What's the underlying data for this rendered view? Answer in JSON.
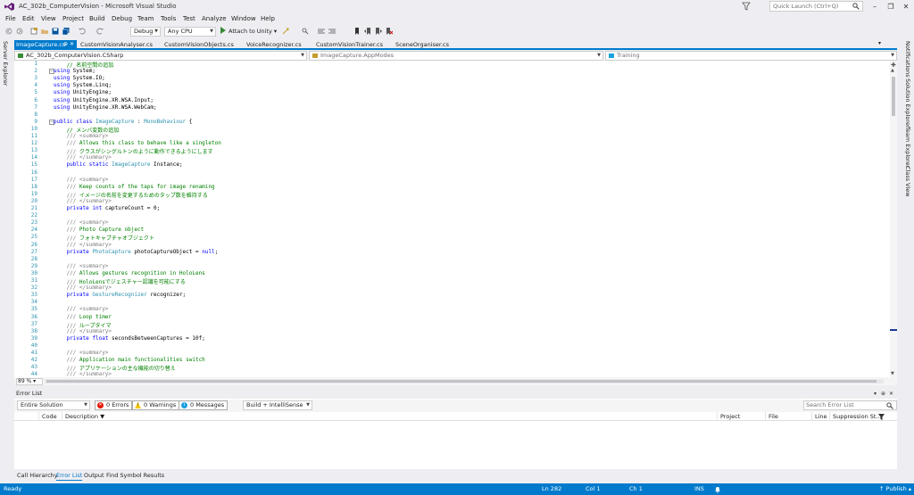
{
  "window": {
    "title": "AC_302b_ComputerVision - Microsoft Visual Studio"
  },
  "quick_launch": {
    "placeholder": "Quick Launch (Ctrl+Q)"
  },
  "menu": [
    "File",
    "Edit",
    "View",
    "Project",
    "Build",
    "Debug",
    "Team",
    "Tools",
    "Test",
    "Analyze",
    "Window",
    "Help"
  ],
  "toolbar": {
    "config": "Debug",
    "platform": "Any CPU",
    "run_label": "Attach to Unity"
  },
  "left_sidebar": {
    "label": "Server Explorer"
  },
  "right_sidebar": [
    "Notifications",
    "Solution Explorer",
    "Team Explorer",
    "Class View"
  ],
  "tabs": [
    "ImageCapture.cs",
    "CustomVisionAnalyser.cs",
    "CustomVisionObjects.cs",
    "VoiceRecognizer.cs",
    "CustomVisionTrainer.cs",
    "SceneOrganiser.cs"
  ],
  "navbar": {
    "project": "AC_302b_ComputerVision.CSharp",
    "type": "ImageCapture.AppModes",
    "member": "Training"
  },
  "code_lines": [
    {
      "n": "1",
      "t": "    // 名前空間の追加"
    },
    {
      "n": "2",
      "t": "using System;"
    },
    {
      "n": "3",
      "t": "using System.IO;"
    },
    {
      "n": "4",
      "t": "using System.Linq;"
    },
    {
      "n": "5",
      "t": "using UnityEngine;"
    },
    {
      "n": "6",
      "t": "using UnityEngine.XR.WSA.Input;"
    },
    {
      "n": "7",
      "t": "using UnityEngine.XR.WSA.WebCam;"
    },
    {
      "n": "8",
      "t": ""
    },
    {
      "n": "9",
      "t": "public class ImageCapture : MonoBehaviour {"
    },
    {
      "n": "10",
      "t": "    // メンバ変数の追加"
    },
    {
      "n": "11",
      "t": "    /// <summary>"
    },
    {
      "n": "12",
      "t": "    /// Allows this class to behave like a singleton"
    },
    {
      "n": "13",
      "t": "    /// クラスがシングルトンのように動作できるようにします"
    },
    {
      "n": "14",
      "t": "    /// </summary>"
    },
    {
      "n": "15",
      "t": "    public static ImageCapture Instance;"
    },
    {
      "n": "16",
      "t": ""
    },
    {
      "n": "17",
      "t": "    /// <summary>"
    },
    {
      "n": "18",
      "t": "    /// Keep counts of the taps for image renaming"
    },
    {
      "n": "19",
      "t": "    /// イメージの名前を変更するためのタップ数を維持する"
    },
    {
      "n": "20",
      "t": "    /// </summary>"
    },
    {
      "n": "21",
      "t": "    private int captureCount = 0;"
    },
    {
      "n": "22",
      "t": ""
    },
    {
      "n": "23",
      "t": "    /// <summary>"
    },
    {
      "n": "24",
      "t": "    /// Photo Capture object"
    },
    {
      "n": "25",
      "t": "    /// フォトキャプチャオブジェクト"
    },
    {
      "n": "26",
      "t": "    /// </summary>"
    },
    {
      "n": "27",
      "t": "    private PhotoCapture photoCaptureObject = null;"
    },
    {
      "n": "28",
      "t": ""
    },
    {
      "n": "29",
      "t": "    /// <summary>"
    },
    {
      "n": "30",
      "t": "    /// Allows gestures recognition in HoloLens"
    },
    {
      "n": "31",
      "t": "    /// HoloLensでジェスチャー認識を可能にする"
    },
    {
      "n": "32",
      "t": "    /// </summary>"
    },
    {
      "n": "33",
      "t": "    private GestureRecognizer recognizer;"
    },
    {
      "n": "34",
      "t": ""
    },
    {
      "n": "35",
      "t": "    /// <summary>"
    },
    {
      "n": "36",
      "t": "    /// Loop timer"
    },
    {
      "n": "37",
      "t": "    /// ループタイマ"
    },
    {
      "n": "38",
      "t": "    /// </summary>"
    },
    {
      "n": "39",
      "t": "    private float secondsBetweenCaptures = 10f;"
    },
    {
      "n": "40",
      "t": ""
    },
    {
      "n": "41",
      "t": "    /// <summary>"
    },
    {
      "n": "42",
      "t": "    /// Application main functionalities switch"
    },
    {
      "n": "43",
      "t": "    /// アプリケーションの主な機能の切り替え"
    },
    {
      "n": "44",
      "t": "    /// </summary>"
    }
  ],
  "zoom": "89 %",
  "error_list": {
    "title": "Error List",
    "scope": "Entire Solution",
    "errors": "0 Errors",
    "warnings": "0 Warnings",
    "messages": "0 Messages",
    "source": "Build + IntelliSense",
    "search_placeholder": "Search Error List",
    "columns": [
      "Code",
      "Description",
      "Project",
      "File",
      "Line",
      "Suppression St..."
    ]
  },
  "bottom_tabs": [
    "Call Hierarchy",
    "Error List",
    "Output",
    "Find Symbol Results"
  ],
  "status": {
    "ready": "Ready",
    "ln": "Ln 282",
    "col": "Col 1",
    "ch": "Ch 1",
    "ins": "INS",
    "publish": "Publish"
  },
  "colors": {
    "accent": "#007acc",
    "keyword": "#0000ff",
    "type": "#2b91af",
    "comment": "#008000"
  }
}
